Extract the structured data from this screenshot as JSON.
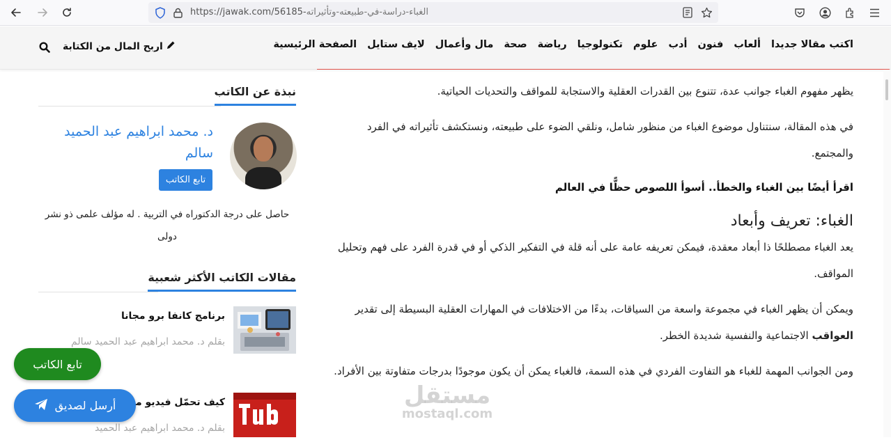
{
  "browser": {
    "url_host": "https://jawak.com/56185-",
    "url_path": "الغباء-دراسة-في-طبيعته-وتأثيراته",
    "icons": [
      "back-icon",
      "forward-icon",
      "reload-icon",
      "shield-icon",
      "lock-icon",
      "reader-icon",
      "bookmark-star-icon",
      "pocket-icon",
      "account-icon",
      "extensions-icon",
      "menu-icon"
    ]
  },
  "header": {
    "nav": [
      "الصفحة الرئيسية",
      "لايف ستايل",
      "مال وأعمال",
      "صحة",
      "رياضة",
      "تكنولوجيا",
      "علوم",
      "أدب",
      "فنون",
      "ألعاب",
      "اكتب مقالا جديدا"
    ],
    "earn_link": "اربح المال من الكتابة",
    "accent": "#e0524a"
  },
  "article": {
    "p1": "يظهر مفهوم الغباء جوانب عدة، تتنوع بين القدرات العقلية والاستجابة للمواقف والتحديات الحياتية.",
    "p2": "في هذه المقالة، سنتناول موضوع الغباء من منظور شامل، ونلقي الضوء على طبيعته، ونستكشف تأثيراته في الفرد والمجتمع.",
    "related": "اقرأ أيضًا بين الغباء والخطأ.. أسوأ اللصوص حظًّا في العالم",
    "heading": "الغباء: تعريف وأبعاد",
    "p3": "يعد الغباء مصطلحًا ذا أبعاد معقدة، فيمكن تعريفه عامة على أنه قلة في التفكير الذكي أو في قدرة الفرد على فهم وتحليل المواقف.",
    "p4_before": "ويمكن أن يظهر الغباء في مجموعة واسعة من السياقات، بدءًا من الاختلافات في المهارات العقلية البسيطة إلى تقدير ",
    "p4_bold": "العواقب",
    "p4_after": " الاجتماعية والنفسية شديدة الخطر.",
    "p5": "ومن الجوانب المهمة للغباء هو التفاوت الفردي في هذه السمة، فالغباء يمكن أن يكون موجودًا بدرجات متفاوتة بين الأفراد."
  },
  "sidebar": {
    "about_title": "نبذة عن الكاتب",
    "author_name": "د. محمد ابراهيم عبد الحميد سالم",
    "follow_label": "تابع الكاتب",
    "bio": "حاصل على درجة الدكتوراه في التربية . له مؤلف علمى ذو نشر دولى",
    "popular_title": "مقالات الكاتب الأكثر شعبية",
    "popular": [
      {
        "title": "برنامج كانفا برو مجانا",
        "meta": "بقلم د. محمد ابراهيم عبد الحميد سالم"
      },
      {
        "title": "كيف تحمّل فيديو من",
        "meta": "بقلم د. محمد ابراهيم عبد الحميد"
      }
    ],
    "accent": "#2d82e0"
  },
  "floating": {
    "follow": "تابع الكاتب",
    "send": "أرسل لصديق"
  },
  "watermark": {
    "arabic": "مستقل",
    "latin": "mostaql.com"
  }
}
